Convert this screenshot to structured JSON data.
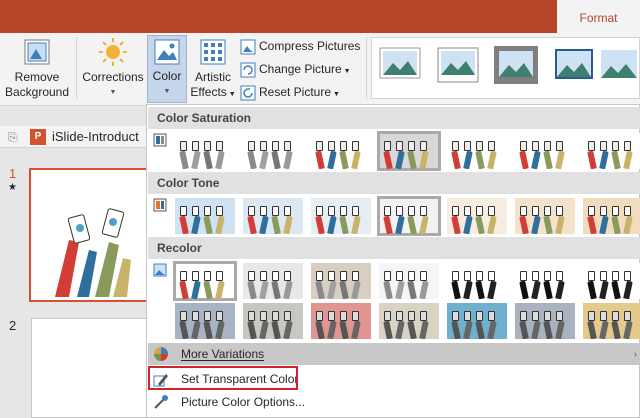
{
  "titlebar": {
    "tab_format": "Format",
    "accent": "#b7472a"
  },
  "ribbon": {
    "remove_background": {
      "line1": "Remove",
      "line2": "Background",
      "icon": "remove-background-icon"
    },
    "corrections": {
      "label": "Corrections",
      "icon": "sun-icon"
    },
    "color": {
      "label": "Color",
      "icon": "color-picture-icon"
    },
    "artistic_effects": {
      "line1": "Artistic",
      "line2": "Effects",
      "icon": "artistic-effects-icon"
    },
    "compress_pictures": "Compress Pictures",
    "change_picture": "Change Picture",
    "reset_picture": "Reset Picture"
  },
  "left_pane": {
    "file_tab": "iSlide-Introduct",
    "slide1_number": "1",
    "slide1_star": "★",
    "slide2_number": "2"
  },
  "menu": {
    "color_saturation": "Color Saturation",
    "color_tone": "Color Tone",
    "recolor": "Recolor",
    "more_variations": "More Variations",
    "set_transparent_color": "Set Transparent Color",
    "picture_color_options": "Picture Color Options..."
  },
  "colors": {
    "selection_red": "#d2232a",
    "menu_hover": "#c8c8c8"
  }
}
